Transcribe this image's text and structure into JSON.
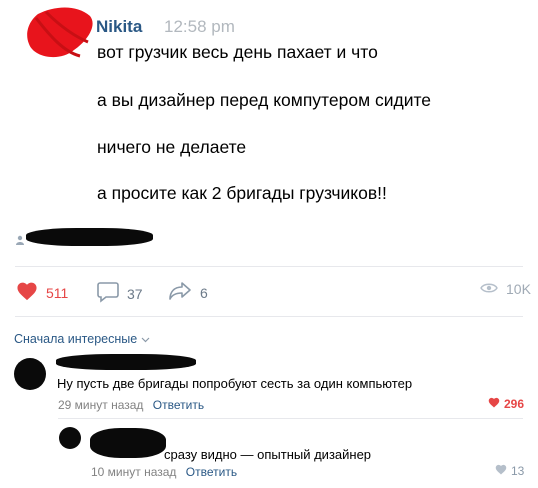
{
  "post": {
    "author": "Nikita",
    "time": "12:58 pm",
    "lines": [
      "вот грузчик весь день пахает и что",
      "а вы дизайнер перед компутером сидите",
      "ничего не делаете",
      "а просите как 2 бригады грузчиков!!"
    ]
  },
  "actions": {
    "likes": "511",
    "comments": "37",
    "shares": "6",
    "views": "10K"
  },
  "comments_header": {
    "sort_label": "Сначала интересные"
  },
  "comments": [
    {
      "text": "Ну пусть две бригады попробуют сесть за один компьютер",
      "time": "29 минут назад",
      "reply_label": "Ответить",
      "likes": "296"
    },
    {
      "text": "сразу видно — опытный дизайнер",
      "time": "10 минут назад",
      "reply_label": "Ответить",
      "likes": "13"
    }
  ],
  "colors": {
    "link": "#2a5885",
    "like": "#e64646",
    "muted": "#828282",
    "avatar_scribble": "#e8141c"
  },
  "icons": [
    "heart-icon",
    "comment-icon",
    "share-icon",
    "eye-icon",
    "chevron-down-icon",
    "user-icon"
  ]
}
